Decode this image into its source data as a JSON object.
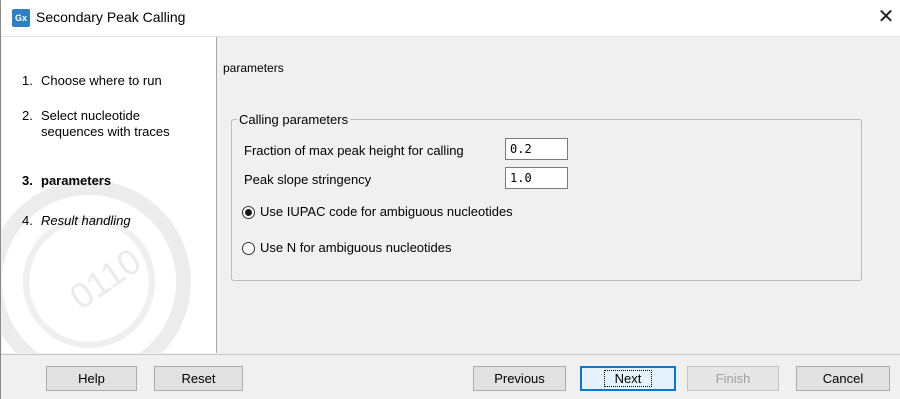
{
  "window": {
    "title": "Secondary Peak Calling",
    "app_icon_text": "Gx",
    "close_glyph": "✕",
    "app_icon_color": "#2f7fc3"
  },
  "steps": [
    {
      "num": "1.",
      "label": "Choose where to run",
      "state": "normal"
    },
    {
      "num": "2.",
      "label_line1": "Select nucleotide",
      "label_line2": "sequences with traces",
      "state": "normal"
    },
    {
      "num": "3.",
      "label": "parameters",
      "state": "current"
    },
    {
      "num": "4.",
      "label": "Result handling",
      "state": "italic"
    }
  ],
  "panel": {
    "title": "parameters",
    "group_title": "Calling parameters",
    "fields": [
      {
        "label": "Fraction of max peak height for calling",
        "value": "0.2"
      },
      {
        "label": "Peak slope stringency",
        "value": "1.0"
      }
    ],
    "radios": [
      {
        "label": "Use IUPAC code for ambiguous nucleotides",
        "selected": true
      },
      {
        "label": "Use N for ambiguous nucleotides",
        "selected": false
      }
    ]
  },
  "buttons": {
    "help": "Help",
    "reset": "Reset",
    "previous": "Previous",
    "next": "Next",
    "finish": "Finish",
    "cancel": "Cancel"
  },
  "icons": {
    "app": "workbench-app-icon",
    "close": "close-icon",
    "sidebar_watermark": "binary-watermark-icon"
  }
}
